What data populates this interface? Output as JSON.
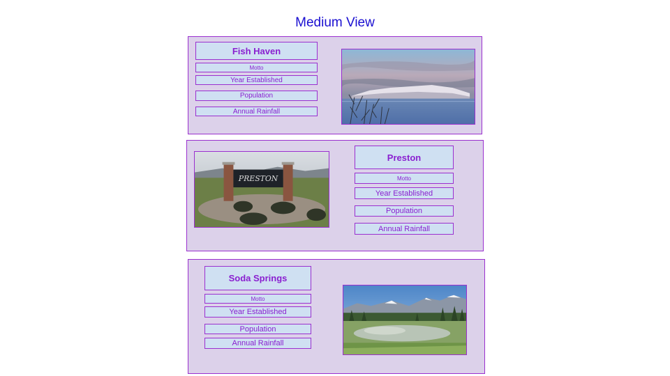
{
  "page": {
    "title": "Medium View"
  },
  "towns": [
    {
      "name": "Fish Haven",
      "fields": [
        "Motto",
        "Year Established",
        "Population",
        "Annual Rainfall"
      ],
      "image": "lake-mountain-photo"
    },
    {
      "name": "Preston",
      "fields": [
        "Motto",
        "Year Established",
        "Population",
        "Annual Rainfall"
      ],
      "image": "preston-sign-photo",
      "sign_text": "PRESTON"
    },
    {
      "name": "Soda Springs",
      "fields": [
        "Motto",
        "Year Established",
        "Population",
        "Annual Rainfall"
      ],
      "image": "meadow-mountain-photo"
    }
  ],
  "colors": {
    "title": "#1a0fd1",
    "card_bg": "#dcd1ea",
    "box_bg": "#cfe0f2",
    "border": "#9a2fcf",
    "text": "#8a1fd0"
  }
}
